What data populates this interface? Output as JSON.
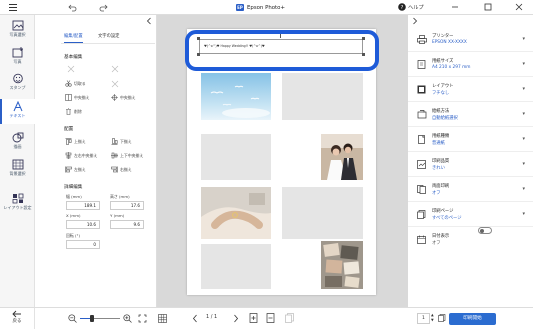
{
  "title_bar": {
    "app_title": "Epson Photo+",
    "app_badge": "EP",
    "help_label": "ヘルプ"
  },
  "rail": {
    "items": [
      {
        "label": "写真選択"
      },
      {
        "label": "写真"
      },
      {
        "label": "スタンプ"
      },
      {
        "label": "テキスト"
      },
      {
        "label": "描画"
      },
      {
        "label": "背景選択"
      },
      {
        "label": "レイアウト設定"
      }
    ],
    "back_label": "戻る"
  },
  "left_panel": {
    "tabs": [
      "編集/配置",
      "文字の設定"
    ],
    "basic_edit_title": "基本編集",
    "basic_edit_buttons": {
      "cut": "切取る",
      "align_center": "中央揃え",
      "delete": "削除",
      "other": "中央揃え"
    },
    "arrange_title": "配置",
    "arrange_buttons": [
      "上揃え",
      "下揃え",
      "左右中央揃え",
      "上下中央揃え",
      "左揃え",
      "右揃え"
    ],
    "detail_title": "詳細編集",
    "fields": {
      "width_label": "幅 (mm)",
      "width_value": "189.1",
      "height_label": "高さ (mm)",
      "height_value": "17.6",
      "x_label": "X (mm)",
      "x_value": "10.6",
      "y_label": "Y (mm)",
      "y_value": "9.6",
      "rotate_label": "回転 (°)",
      "rotate_value": "0"
    }
  },
  "canvas": {
    "text_content": "♥(^o^)♥ Happy Wedding!! ♥(^o^)♥"
  },
  "right_panel": {
    "rows": [
      {
        "label": "プリンター",
        "value": "EPSON XX-XXXX"
      },
      {
        "label": "用紙サイズ",
        "value": "A4 210 x 297 mm"
      },
      {
        "label": "レイアウト",
        "value": "フチなし"
      },
      {
        "label": "給紙方法",
        "value": "自動給紙選択"
      },
      {
        "label": "用紙種類",
        "value": "普通紙"
      },
      {
        "label": "印刷品質",
        "value": "きれい"
      },
      {
        "label": "両面印刷",
        "value": "オフ"
      },
      {
        "label": "印刷ページ",
        "value": "すべてのページ"
      },
      {
        "label": "日付表示",
        "value": "オフ"
      }
    ]
  },
  "bottom_bar": {
    "page_indicator": "1 / 1",
    "copies": "1",
    "print_button": "印刷開始"
  },
  "colors": {
    "accent": "#2b5fc7",
    "selection_ring": "#1e5bd8",
    "print_button": "#2b6cd0"
  }
}
